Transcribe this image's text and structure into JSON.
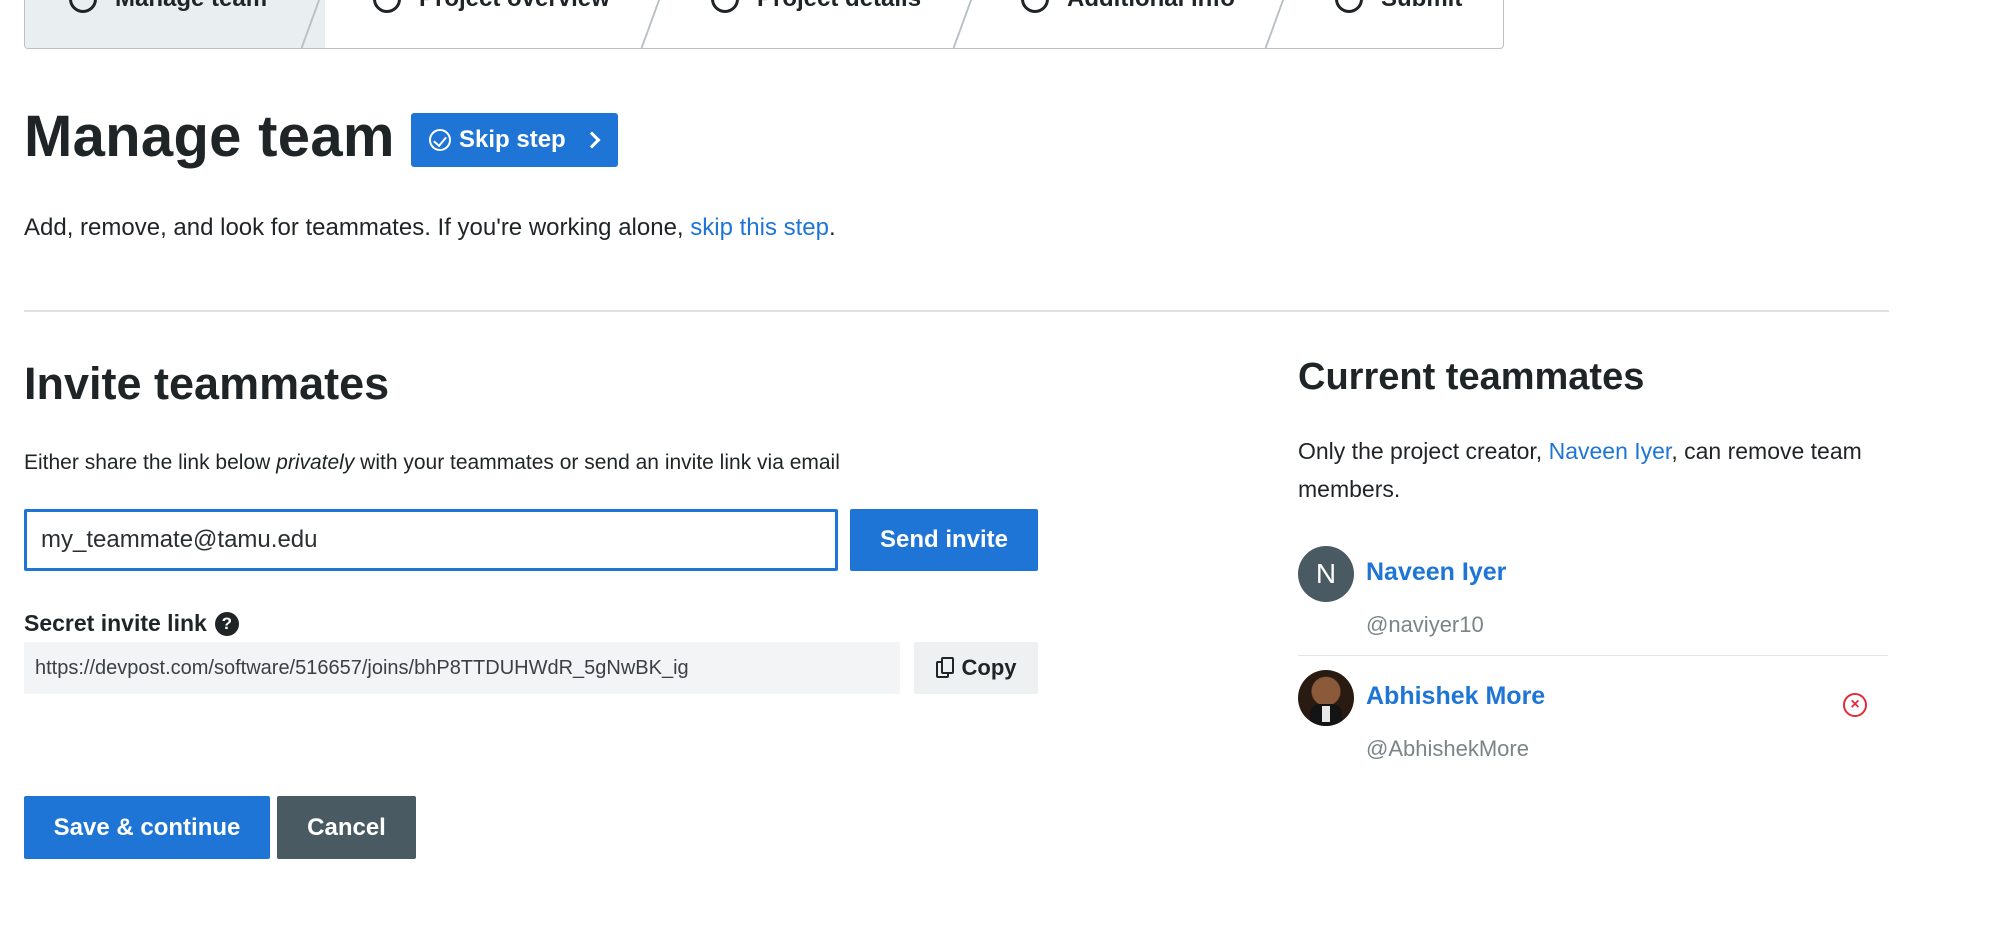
{
  "steps": [
    {
      "label": "Manage team"
    },
    {
      "label": "Project overview"
    },
    {
      "label": "Project details"
    },
    {
      "label": "Additional info"
    },
    {
      "label": "Submit"
    }
  ],
  "header": {
    "title": "Manage team",
    "skip_button": "Skip step"
  },
  "intro": {
    "text": "Add, remove, and look for teammates. If you're working alone, ",
    "link": "skip this step",
    "suffix": "."
  },
  "invite": {
    "heading": "Invite teammates",
    "desc_before": "Either share the link below ",
    "desc_em": "privately",
    "desc_after": " with your teammates or send an invite link via email",
    "email_value": "my_teammate@tamu.edu",
    "send_button": "Send invite",
    "secret_label": "Secret invite link",
    "secret_link": "https://devpost.com/software/516657/joins/bhP8TTDUHWdR_5gNwBK_ig",
    "copy_button": "Copy"
  },
  "actions": {
    "save": "Save & continue",
    "cancel": "Cancel"
  },
  "current": {
    "heading": "Current teammates",
    "desc_before": "Only the project creator, ",
    "creator_link": "Naveen Iyer",
    "desc_after": ", can remove team members.",
    "members": [
      {
        "initial": "N",
        "name": "Naveen Iyer",
        "handle": "@naviyer10"
      },
      {
        "name": "Abhishek More",
        "handle": "@AbhishekMore"
      }
    ]
  },
  "colors": {
    "accent": "#1e75d6",
    "dark_button": "#4a5a62",
    "danger": "#e02b3c"
  }
}
